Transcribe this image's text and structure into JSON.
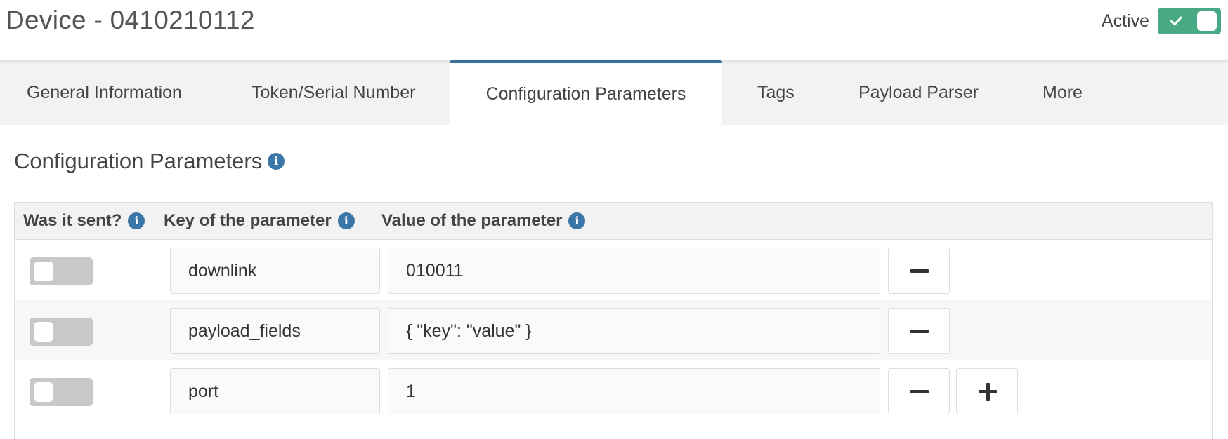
{
  "header": {
    "title": "Device - 0410210112",
    "active_label": "Active",
    "active": true
  },
  "tabs": [
    {
      "label": "General Information"
    },
    {
      "label": "Token/Serial Number"
    },
    {
      "label": "Configuration Parameters",
      "active": true
    },
    {
      "label": "Tags"
    },
    {
      "label": "Payload Parser"
    },
    {
      "label": "More"
    }
  ],
  "section": {
    "title": "Configuration Parameters",
    "info_icon": "info-icon"
  },
  "table": {
    "headers": {
      "sent": "Was it sent?",
      "key": "Key of the parameter",
      "value": "Value of the parameter"
    },
    "rows": [
      {
        "sent": false,
        "key": "downlink",
        "value": "010011"
      },
      {
        "sent": false,
        "key": "payload_fields",
        "value": "{ \"key\": \"value\" }"
      },
      {
        "sent": false,
        "key": "port",
        "value": "1"
      }
    ]
  },
  "colors": {
    "accent": "#3b76a9",
    "active_toggle": "#4aa985",
    "inactive_toggle": "#c8c8c8"
  }
}
